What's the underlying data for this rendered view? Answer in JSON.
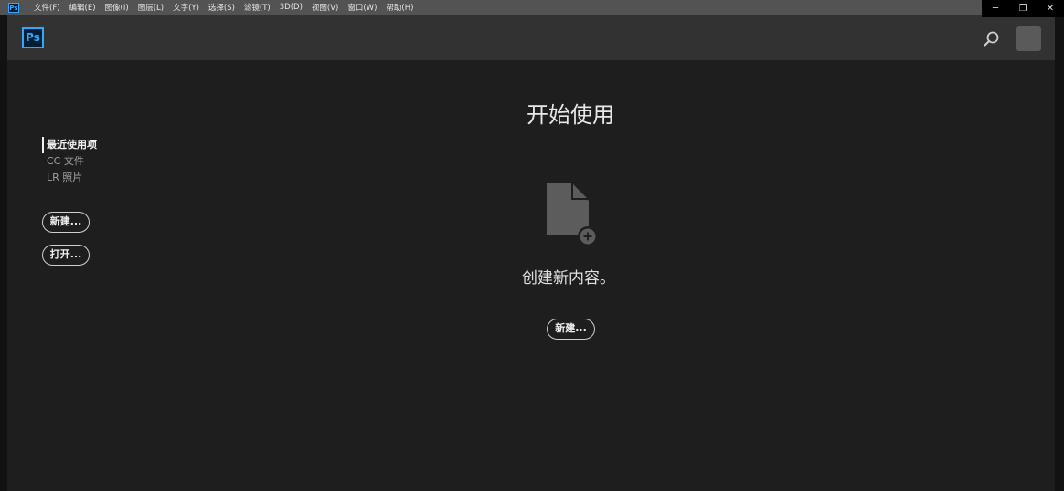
{
  "menubar": {
    "app_badge": "Ps",
    "items": [
      {
        "label": "文件(F)"
      },
      {
        "label": "编辑(E)"
      },
      {
        "label": "图像(I)"
      },
      {
        "label": "图层(L)"
      },
      {
        "label": "文字(Y)"
      },
      {
        "label": "选择(S)"
      },
      {
        "label": "滤镜(T)"
      },
      {
        "label": "3D(D)"
      },
      {
        "label": "视图(V)"
      },
      {
        "label": "窗口(W)"
      },
      {
        "label": "帮助(H)"
      }
    ]
  },
  "window_controls": {
    "minimize": "─",
    "restore": "❐",
    "close": "✕"
  },
  "header": {
    "logo": "Ps",
    "search_icon": "search-icon",
    "avatar_icon": "avatar"
  },
  "sidebar": {
    "items": [
      {
        "label": "最近使用项",
        "active": true
      },
      {
        "label": "CC 文件",
        "active": false
      },
      {
        "label": "LR 照片",
        "active": false
      }
    ],
    "new_button": "新建...",
    "open_button": "打开..."
  },
  "main": {
    "title": "开始使用",
    "empty_icon": "document-plus-icon",
    "subtitle": "创建新内容。",
    "new_button": "新建..."
  },
  "colors": {
    "background": "#1e1e1e",
    "header": "#323232",
    "menubar": "#535353",
    "brand_blue": "#31a8ff",
    "brand_dark": "#001e36"
  }
}
